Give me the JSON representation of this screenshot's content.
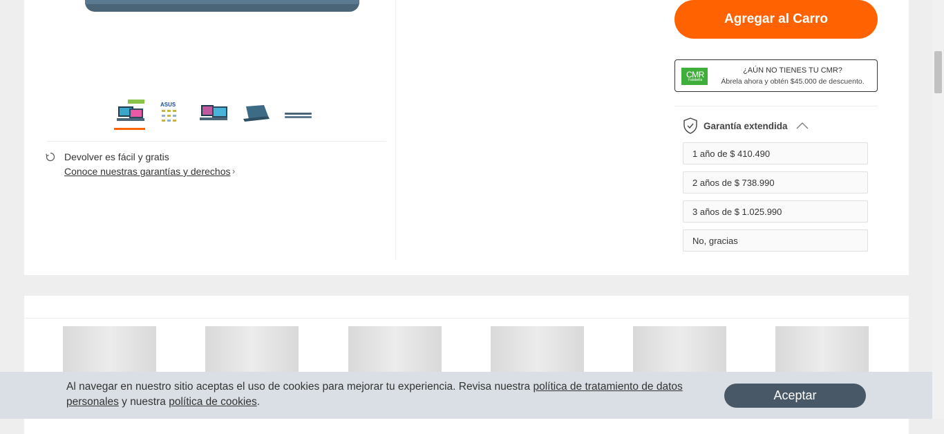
{
  "product": {
    "return_text": "Devolver es fácil y gratis",
    "return_link": "Conoce nuestras garantías y derechos",
    "thumbnails": [
      "laptop-front",
      "asus-specs",
      "laptop-angle",
      "laptop-back",
      "laptop-side"
    ]
  },
  "purchase": {
    "add_to_cart": "Agregar al Carro",
    "cmr": {
      "logo_line1": "CMR",
      "logo_line2": "Falabella",
      "title": "¿AÚN NO TIENES TU CMR?",
      "subtitle": "Ábrela ahora y obtén $45.000 de descuento."
    }
  },
  "warranty": {
    "title": "Garantía extendida",
    "options": [
      "1 año de $ 410.490",
      "2 años de $ 738.990",
      "3 años de $ 1.025.990",
      "No, gracias"
    ]
  },
  "cookies": {
    "text_before": "Al navegar en nuestro sitio aceptas el uso de cookies para mejorar tu experiencia. Revisa nuestra ",
    "link_privacy": "política de tratamiento de datos personales",
    "text_middle": " y nuestra ",
    "link_cookies": "política de cookies",
    "text_after": ".",
    "accept": "Aceptar"
  },
  "colors": {
    "accent": "#ff6200",
    "cmr_green": "#3fae3a",
    "accept_button": "#495867",
    "cookie_bar": "#d9dfe4"
  }
}
